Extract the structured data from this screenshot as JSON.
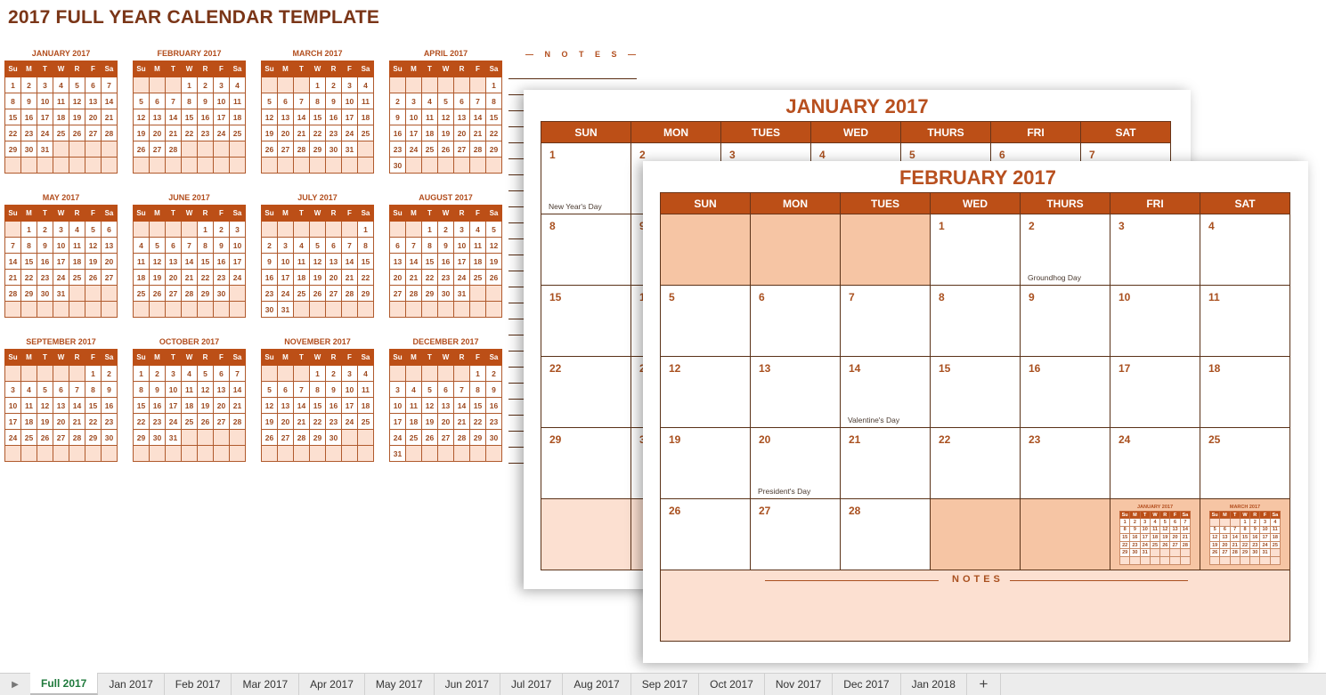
{
  "title": "2017 FULL YEAR CALENDAR TEMPLATE",
  "weekday_abbrev": [
    "Su",
    "M",
    "T",
    "W",
    "R",
    "F",
    "Sa"
  ],
  "weekday_full": [
    "SUN",
    "MON",
    "TUES",
    "WED",
    "THURS",
    "FRI",
    "SAT"
  ],
  "months": [
    {
      "name": "JANUARY 2017",
      "start": 0,
      "days": 31
    },
    {
      "name": "FEBRUARY 2017",
      "start": 3,
      "days": 28
    },
    {
      "name": "MARCH 2017",
      "start": 3,
      "days": 31
    },
    {
      "name": "APRIL 2017",
      "start": 6,
      "days": 30
    },
    {
      "name": "MAY 2017",
      "start": 1,
      "days": 31
    },
    {
      "name": "JUNE 2017",
      "start": 4,
      "days": 30
    },
    {
      "name": "JULY 2017",
      "start": 6,
      "days": 31
    },
    {
      "name": "AUGUST 2017",
      "start": 2,
      "days": 31
    },
    {
      "name": "SEPTEMBER 2017",
      "start": 5,
      "days": 30
    },
    {
      "name": "OCTOBER 2017",
      "start": 0,
      "days": 31
    },
    {
      "name": "NOVEMBER 2017",
      "start": 3,
      "days": 30
    },
    {
      "name": "DECEMBER 2017",
      "start": 5,
      "days": 31
    }
  ],
  "notes_label": "— N O T E S —",
  "january_page": {
    "title": "JANUARY 2017",
    "visible_days": [
      "1",
      "2",
      "3",
      "4",
      "5",
      "6",
      "7",
      "8",
      "9",
      "15",
      "1",
      "22",
      "2",
      "29",
      "3"
    ],
    "holidays": {
      "1": "New Year's Day"
    }
  },
  "february_page": {
    "title": "FEBRUARY 2017",
    "weeks": [
      [
        "",
        "",
        "",
        "1",
        "2",
        "3",
        "4"
      ],
      [
        "5",
        "6",
        "7",
        "8",
        "9",
        "10",
        "11"
      ],
      [
        "12",
        "13",
        "14",
        "15",
        "16",
        "17",
        "18"
      ],
      [
        "19",
        "20",
        "21",
        "22",
        "23",
        "24",
        "25"
      ],
      [
        "26",
        "27",
        "28",
        "",
        "",
        "",
        ""
      ]
    ],
    "holidays": {
      "2": "Groundhog Day",
      "14": "Valentine's Day",
      "20": "President's Day"
    },
    "prev_month_mini": "JANUARY 2017",
    "next_month_mini": "MARCH 2017",
    "notes_label": "NOTES"
  },
  "tabs": [
    "Full 2017",
    "Jan 2017",
    "Feb 2017",
    "Mar 2017",
    "Apr 2017",
    "May 2017",
    "Jun 2017",
    "Jul 2017",
    "Aug 2017",
    "Sep 2017",
    "Oct 2017",
    "Nov 2017",
    "Dec 2017",
    "Jan 2018"
  ],
  "active_tab": "Full 2017",
  "add_tab_label": "+",
  "colors": {
    "accent": "#bc4f17",
    "title": "#7a3517",
    "empty_cell": "#fce0d1",
    "blank_cell": "#f6c5a4",
    "active_tab": "#1f7a3c"
  }
}
